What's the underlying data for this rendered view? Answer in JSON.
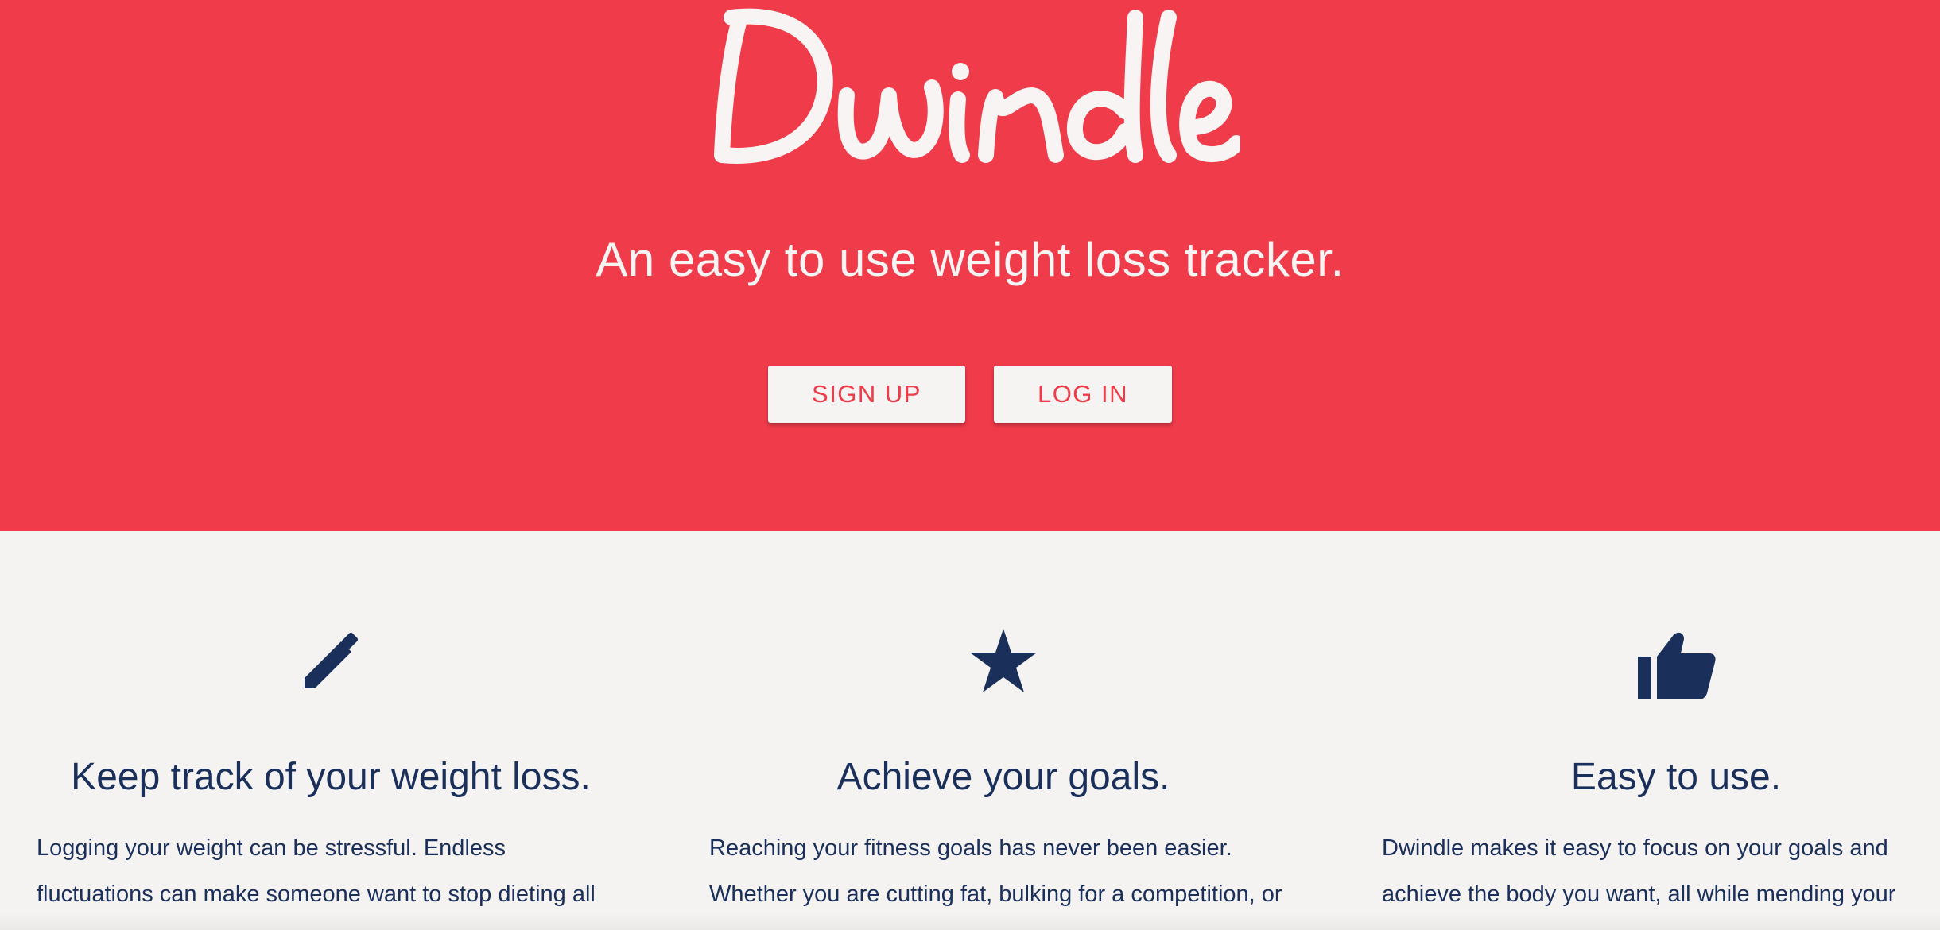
{
  "hero": {
    "brand_name": "Dwindle",
    "tagline": "An easy to use weight loss tracker.",
    "signup_label": "SIGN UP",
    "login_label": "LOG IN"
  },
  "features": [
    {
      "icon": "pencil-icon",
      "title": "Keep track of your weight loss.",
      "text": "Logging your weight can be stressful. Endless fluctuations can make someone want to stop dieting all"
    },
    {
      "icon": "star-icon",
      "title": "Achieve your goals.",
      "text": "Reaching your fitness goals has never been easier. Whether you are cutting fat, bulking for a competition, or"
    },
    {
      "icon": "thumbs-up-icon",
      "title": "Easy to use.",
      "text": "Dwindle makes it easy to focus on your goals and achieve the body you want, all while mending your"
    }
  ],
  "colors": {
    "brand_red": "#ef3b4a",
    "navy": "#1a2f5a",
    "background": "#f5f3f2"
  }
}
